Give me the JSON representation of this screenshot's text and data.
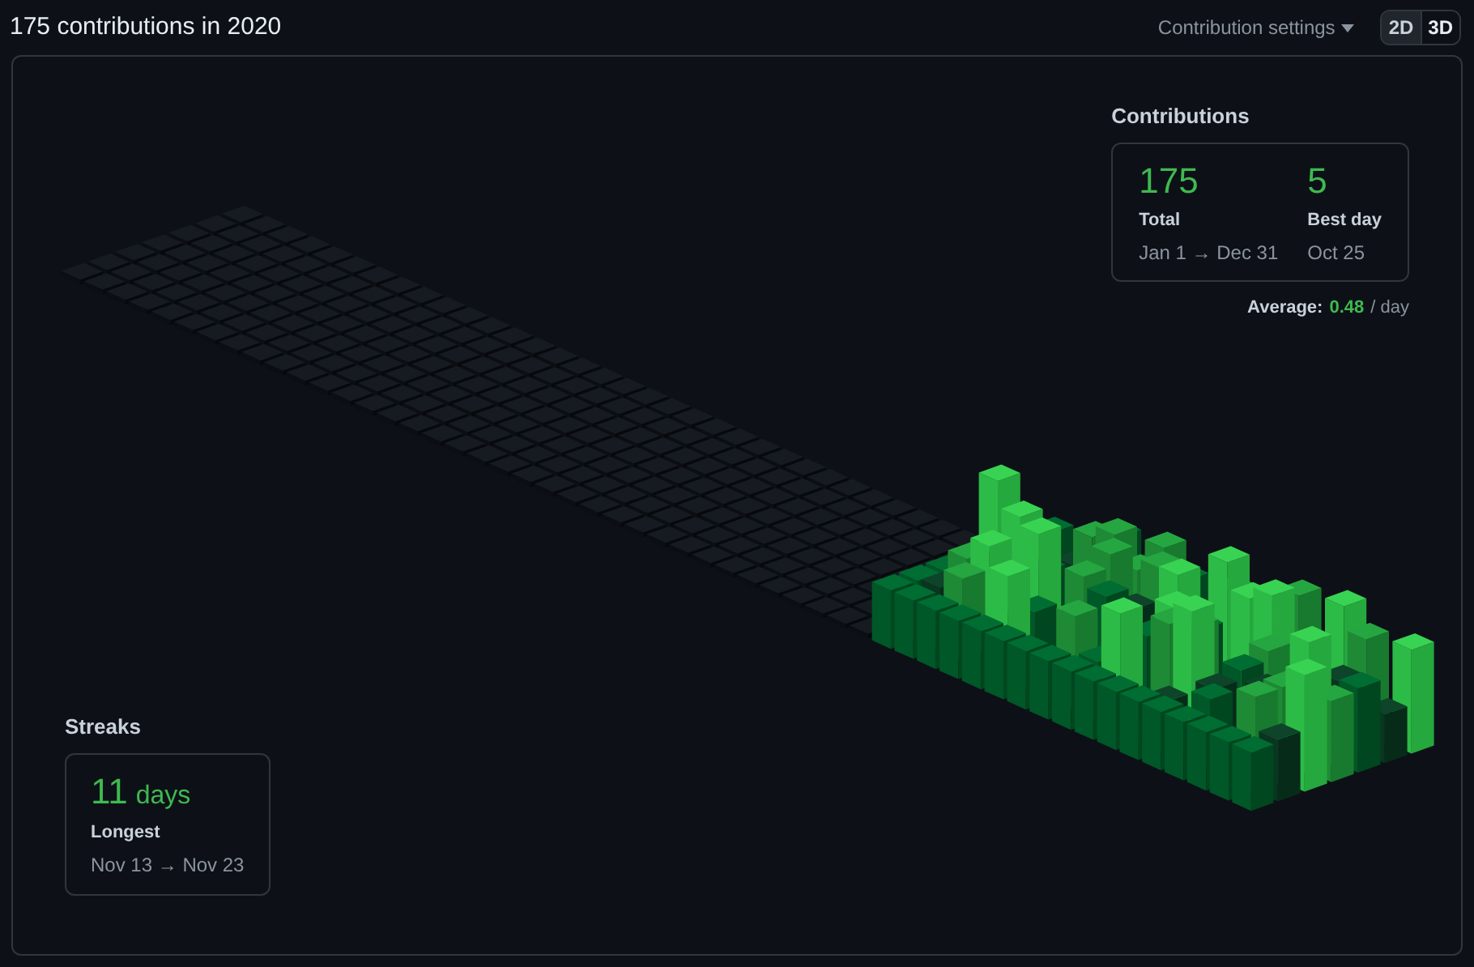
{
  "header": {
    "title": "175 contributions in 2020",
    "settings_button": "Contribution settings",
    "view_toggle": [
      {
        "label": "2D",
        "selected": false
      },
      {
        "label": "3D",
        "selected": true
      }
    ]
  },
  "contributions": {
    "heading": "Contributions",
    "stats": [
      {
        "value": "175",
        "label": "Total",
        "range": "Jan 1 → Dec 31"
      },
      {
        "value": "5",
        "label": "Best day",
        "range": "Oct 25"
      }
    ],
    "average": {
      "label": "Average:",
      "value": "0.48",
      "unit": "/ day"
    }
  },
  "streaks": {
    "heading": "Streaks",
    "value": "11",
    "unit": "days",
    "label": "Longest",
    "range": "Nov 13 → Nov 23"
  }
}
